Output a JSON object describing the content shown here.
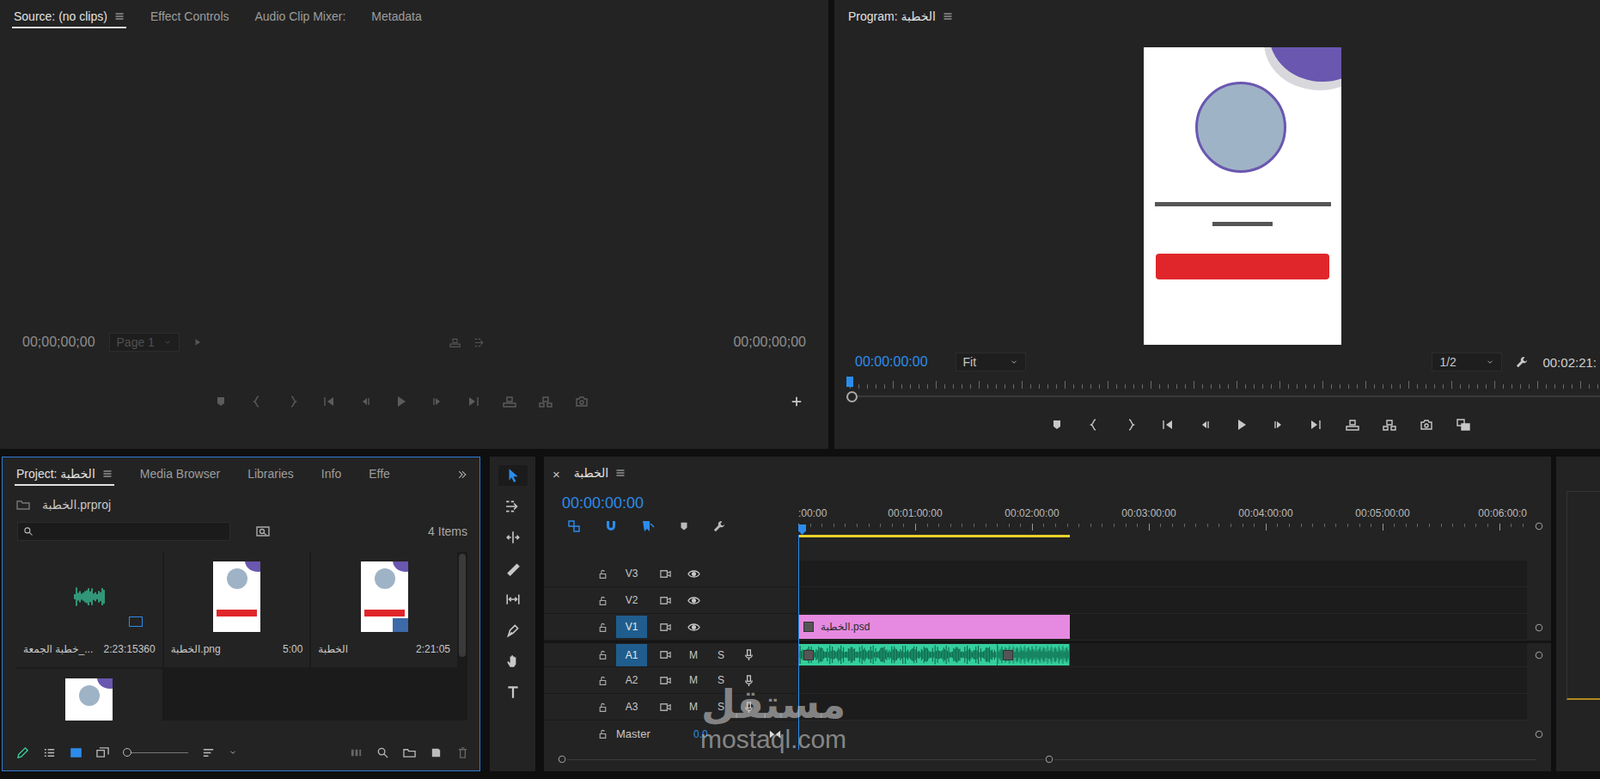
{
  "source": {
    "tabs": [
      {
        "label": "Source: (no clips)",
        "selected": true
      },
      {
        "label": "Effect Controls",
        "selected": false
      },
      {
        "label": "Audio Clip Mixer:",
        "selected": false
      },
      {
        "label": "Metadata",
        "selected": false
      }
    ],
    "timecode_in": "00;00;00;00",
    "timecode_out": "00;00;00;00",
    "page": "Page 1",
    "disabled": true
  },
  "program": {
    "title": "Program: الخطبة",
    "timecode": "00:00:00:00",
    "zoom": "Fit",
    "resolution": "1/2",
    "duration": "00:02:21:",
    "playhead": {
      "level": 0
    }
  },
  "project": {
    "tabs": [
      {
        "label": "Project: الخطبة",
        "selected": true
      },
      {
        "label": "Media Browser",
        "selected": false
      },
      {
        "label": "Libraries",
        "selected": false
      },
      {
        "label": "Info",
        "selected": false
      },
      {
        "label": "Effe",
        "selected": false
      }
    ],
    "file": "الخطبة.prproj",
    "count": "4 Items",
    "items": [
      {
        "kind": "audio",
        "name": "خطبة الجمعة_...",
        "duration": "2:23:15360"
      },
      {
        "kind": "image",
        "name": "الخطبة.png",
        "duration": "5:00"
      },
      {
        "kind": "sequence",
        "name": "الخطبة",
        "duration": "2:21:05"
      },
      {
        "kind": "image"
      }
    ],
    "view_modes": [
      {
        "selected": false
      },
      {
        "selected": true
      },
      {
        "selected": false
      }
    ],
    "zoom": {
      "level": 0
    }
  },
  "tools": [
    {
      "selected": true
    },
    {
      "selected": false
    },
    {
      "selected": false
    },
    {
      "selected": false
    },
    {
      "selected": false
    },
    {
      "selected": false
    },
    {
      "selected": false
    },
    {
      "selected": false
    }
  ],
  "timeline": {
    "tab": "الخطبة",
    "close": "×",
    "timecode": "00:00:00:00",
    "toggles": [
      {
        "on": true
      },
      {
        "on": true
      },
      {
        "on": true
      }
    ],
    "ruler": [
      ":00:00",
      "00:01:00:00",
      "00:02:00:00",
      "00:03:00:00",
      "00:04:00:00",
      "00:05:00:00",
      "00:06:00:0"
    ],
    "work_area": {
      "level": 0.373
    },
    "playhead": {
      "level": 0
    },
    "mute_label": "M",
    "solo_label": "S",
    "tracks": [
      {
        "name": "V3",
        "kind": "video",
        "targeted": false,
        "clips": []
      },
      {
        "name": "V2",
        "kind": "video",
        "targeted": false,
        "clips": []
      },
      {
        "name": "V1",
        "kind": "video",
        "targeted": true,
        "clips": [
          {
            "label": "الخطبة.psd",
            "start": 0,
            "end": 0.373
          }
        ]
      },
      {
        "name": "A1",
        "kind": "audio",
        "targeted": true,
        "clips": [
          {
            "start": 0,
            "end": 0.273
          },
          {
            "start": 0.273,
            "end": 0.373
          }
        ]
      },
      {
        "name": "A2",
        "kind": "audio",
        "targeted": false,
        "clips": []
      },
      {
        "name": "A3",
        "kind": "audio",
        "targeted": false,
        "clips": []
      }
    ],
    "master": {
      "name": "Master",
      "value": "0.0"
    }
  },
  "watermark": {
    "title": "مستقل",
    "url": "mostaql.com"
  }
}
